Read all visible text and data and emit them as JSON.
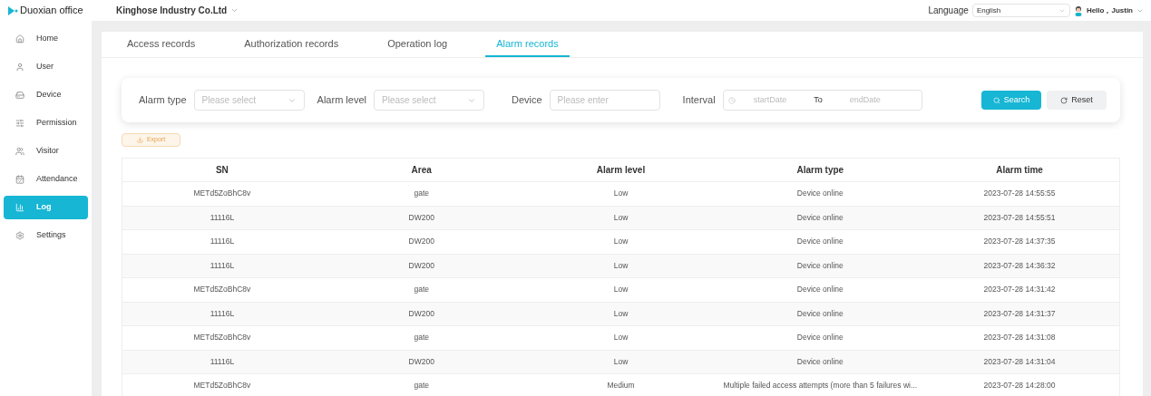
{
  "brand": "Duoxian office",
  "company": "Kinghose Industry Co.Ltd",
  "language": {
    "label": "Language",
    "value": "English"
  },
  "user": {
    "greeting": "Hello，Justin"
  },
  "sidebar": {
    "items": [
      {
        "label": "Home",
        "selected": false
      },
      {
        "label": "User",
        "selected": false
      },
      {
        "label": "Device",
        "selected": false
      },
      {
        "label": "Permission",
        "selected": false
      },
      {
        "label": "Visitor",
        "selected": false
      },
      {
        "label": "Attendance",
        "selected": false
      },
      {
        "label": "Log",
        "selected": true
      },
      {
        "label": "Settings",
        "selected": false
      }
    ]
  },
  "tabs": [
    {
      "label": "Access records",
      "selected": false
    },
    {
      "label": "Authorization records",
      "selected": false
    },
    {
      "label": "Operation log",
      "selected": false
    },
    {
      "label": "Alarm records",
      "selected": true
    }
  ],
  "filters": {
    "alarm_type": {
      "label": "Alarm type",
      "placeholder": "Please select"
    },
    "alarm_level": {
      "label": "Alarm level",
      "placeholder": "Please select"
    },
    "device": {
      "label": "Device",
      "placeholder": "Please enter"
    },
    "interval": {
      "label": "Interval",
      "start_placeholder": "startDate",
      "separator": "To",
      "end_placeholder": "endDate"
    },
    "search": "Search",
    "reset": "Reset"
  },
  "export": "Export",
  "table": {
    "columns": [
      "SN",
      "Area",
      "Alarm level",
      "Alarm type",
      "Alarm time"
    ],
    "rows": [
      [
        "METd5ZoBhC8v",
        "gate",
        "Low",
        "Device online",
        "2023-07-28 14:55:55"
      ],
      [
        "11116L",
        "DW200",
        "Low",
        "Device online",
        "2023-07-28 14:55:51"
      ],
      [
        "11116L",
        "DW200",
        "Low",
        "Device online",
        "2023-07-28 14:37:35"
      ],
      [
        "11116L",
        "DW200",
        "Low",
        "Device online",
        "2023-07-28 14:36:32"
      ],
      [
        "METd5ZoBhC8v",
        "gate",
        "Low",
        "Device online",
        "2023-07-28 14:31:42"
      ],
      [
        "11116L",
        "DW200",
        "Low",
        "Device online",
        "2023-07-28 14:31:37"
      ],
      [
        "METd5ZoBhC8v",
        "gate",
        "Low",
        "Device online",
        "2023-07-28 14:31:08"
      ],
      [
        "11116L",
        "DW200",
        "Low",
        "Device online",
        "2023-07-28 14:31:04"
      ],
      [
        "METd5ZoBhC8v",
        "gate",
        "Medium",
        "Multiple failed access attempts (more than 5 failures wi...",
        "2023-07-28 14:28:00"
      ]
    ]
  }
}
